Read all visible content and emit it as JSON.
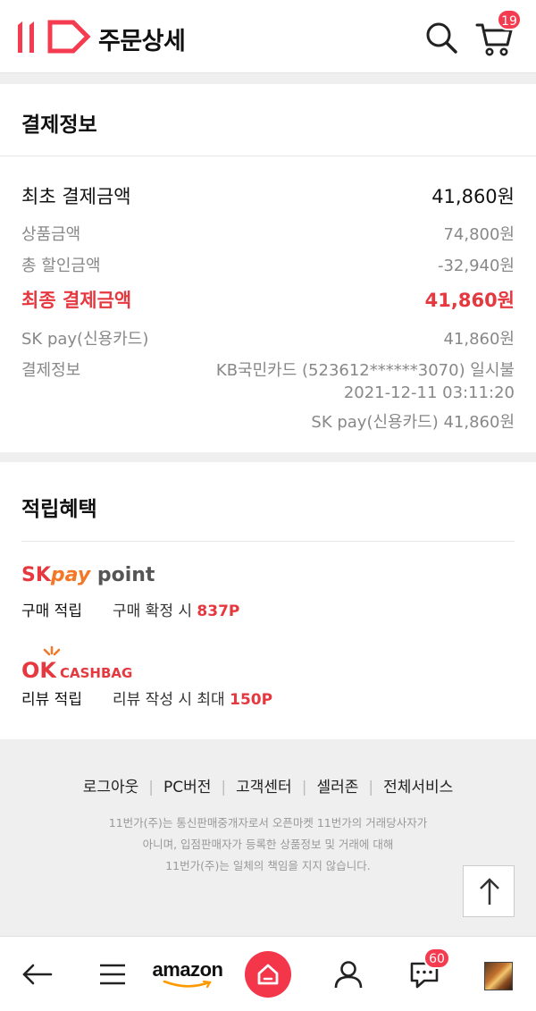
{
  "header": {
    "logo_text": "11",
    "title": "주문상세",
    "cart_count": "19",
    "icons": [
      "search-icon",
      "cart-icon"
    ]
  },
  "payment": {
    "title": "결제정보",
    "initial_amount_label": "최초 결제금액",
    "initial_amount_value": "41,860원",
    "product_amount_label": "상품금액",
    "product_amount_value": "74,800원",
    "discount_label": "총 할인금액",
    "discount_value": "-32,940원",
    "final_amount_label": "최종 결제금액",
    "final_amount_value": "41,860원",
    "method_label": "SK pay(신용카드)",
    "method_value": "41,860원",
    "info_label": "결제정보",
    "info_line1": "KB국민카드 (523612******3070) 일시불",
    "info_line2": "2021-12-11 03:11:20",
    "info_line3": "SK pay(신용카드) 41,860원"
  },
  "points": {
    "title": "적립혜택",
    "skpay_brand_sk": "SK",
    "skpay_brand_pay": "pay",
    "skpay_brand_point": " point",
    "purchase_label": "구매 적립",
    "purchase_desc": "구매 확정 시 ",
    "purchase_value": "837P",
    "ok_brand_ok": "OK",
    "ok_brand_cashbag": "CASHBAG",
    "review_label": "리뷰 적립",
    "review_desc": "리뷰 작성 시 최대 ",
    "review_value": "150P"
  },
  "footer": {
    "links": [
      "로그아웃",
      "PC버전",
      "고객센터",
      "셀러존",
      "전체서비스"
    ],
    "note_line1": "11번가(주)는 통신판매중개자로서 오픈마켓 11번가의 거래당사자가",
    "note_line2": "아니며, 입점판매자가 등록한 상품정보 및 거래에 대해",
    "note_line3": "11번가(주)는 일체의 책임을 지지 않습니다."
  },
  "bottom_nav": {
    "amazon_label": "amazon",
    "chat_count": "60",
    "icons": [
      "back-arrow-icon",
      "menu-icon",
      "amazon-logo",
      "home-icon",
      "user-icon",
      "chat-icon",
      "profile-thumbnail"
    ]
  },
  "colors": {
    "brand_red": "#f53b4f",
    "price_red": "#e5383f",
    "skpay_orange": "#f47725"
  }
}
